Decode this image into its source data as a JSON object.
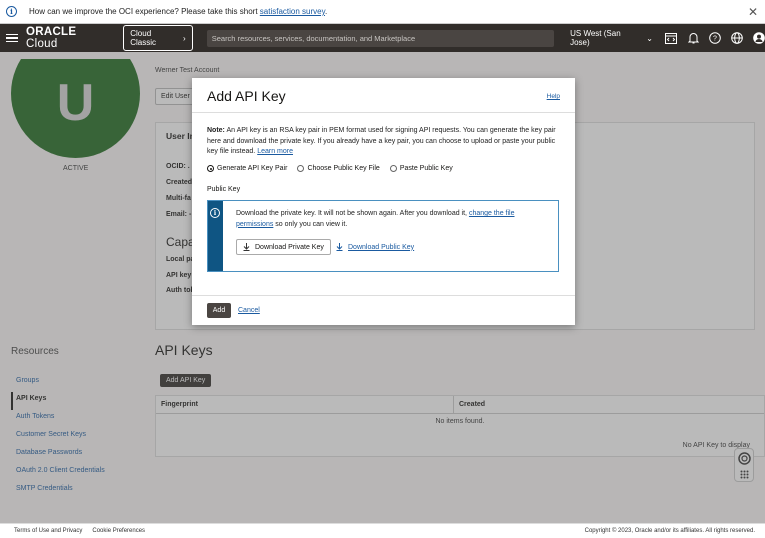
{
  "banner": {
    "text": "How can we improve the OCI experience? Please take this short",
    "link": "satisfaction survey",
    "suffix": "."
  },
  "header": {
    "logo_bold": "ORACLE",
    "logo_light": " Cloud",
    "classic": "Cloud Classic",
    "search_placeholder": "Search resources, services, documentation, and Marketplace",
    "region": "US West (San Jose)"
  },
  "user": {
    "initial": "U",
    "status": "ACTIVE",
    "account": "Werner Test Account",
    "edit": "Edit User",
    "info_title": "User In",
    "fields": [
      "OCID: .",
      "Created",
      "Multi-fa",
      "Email: -"
    ],
    "capabilities": "Capa",
    "cap_fields": [
      "Local pa",
      "API key",
      "Auth tok"
    ]
  },
  "resources": {
    "title": "Resources",
    "items": [
      "Groups",
      "API Keys",
      "Auth Tokens",
      "Customer Secret Keys",
      "Database Passwords",
      "OAuth 2.0 Client Credentials",
      "SMTP Credentials"
    ]
  },
  "api_keys": {
    "title": "API Keys",
    "add_button": "Add API Key",
    "columns": [
      "Fingerprint",
      "Created"
    ],
    "empty": "No items found.",
    "no_key": "No API Key to display"
  },
  "footer": {
    "terms": "Terms of Use and Privacy",
    "cookies": "Cookie Preferences",
    "copyright": "Copyright © 2023, Oracle and/or its affiliates. All rights reserved."
  },
  "modal": {
    "title": "Add API Key",
    "help": "Help",
    "note_label": "Note:",
    "note_text": " An API key is an RSA key pair in PEM format used for signing API requests. You can generate the key pair here and download the private key. If you already have a key pair, you can choose to upload or paste your public key file instead. ",
    "note_link": "Learn more",
    "radios": [
      "Generate API Key Pair",
      "Choose Public Key File",
      "Paste Public Key"
    ],
    "selected_radio": 0,
    "public_key_label": "Public Key",
    "info_text": "Download the private key. It will not be shown again. After you download it, ",
    "info_link": "change the file permissions",
    "info_suffix": " so only you can view it.",
    "download_private": "Download Private Key",
    "download_public": "Download Public Key",
    "add": "Add",
    "cancel": "Cancel"
  },
  "colors": {
    "header_bg": "#312d2a",
    "link": "#1a5aa0",
    "avatar": "#1f6b1f",
    "info_bar": "#0f5583"
  }
}
